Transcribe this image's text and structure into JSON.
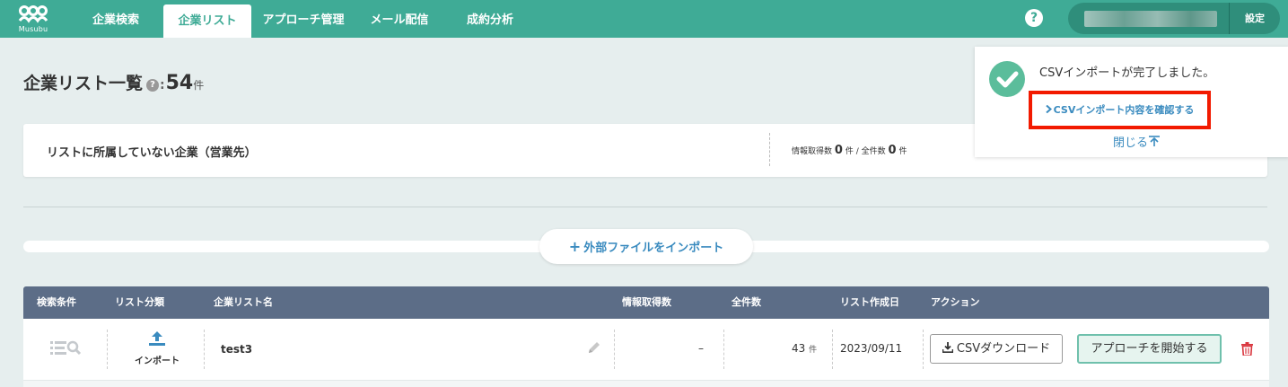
{
  "app": {
    "logo_text": "Musubu"
  },
  "nav": {
    "tabs": [
      {
        "label": "企業検索"
      },
      {
        "label": "企業リスト"
      },
      {
        "label": "アプローチ管理"
      },
      {
        "label": "メール配信"
      },
      {
        "label": "成約分析"
      }
    ],
    "active_tab": "企業リスト",
    "settings_label": "設定",
    "help_glyph": "?"
  },
  "page": {
    "title": "企業リスト一覧",
    "help_glyph": "?",
    "colon": ":",
    "count": "54",
    "count_unit": "件"
  },
  "unassigned": {
    "label": "リストに所属していない企業（営業先）",
    "info_label": "情報取得数",
    "info_count": "0",
    "unit": "件",
    "slash": "/",
    "total_label": "全件数",
    "total_count": "0"
  },
  "import": {
    "plus": "+",
    "label": "外部ファイルをインポート"
  },
  "table": {
    "headers": [
      "検索条件",
      "リスト分類",
      "企業リスト名",
      "情報取得数",
      "全件数",
      "リスト作成日",
      "アクション"
    ],
    "rows": [
      {
        "category": "インポート",
        "name": "test3",
        "info_count": "–",
        "total": "43",
        "total_unit": "件",
        "created": "2023/09/11",
        "csv_label": "CSVダウンロード",
        "approach_label": "アプローチを開始する"
      }
    ]
  },
  "toast": {
    "message": "CSVインポートが完了しました。",
    "confirm_link": "CSVインポート内容を確認する",
    "close_label": "閉じる"
  },
  "colors": {
    "brand": "#3fab96",
    "table_header": "#5c6d87",
    "link": "#3a8bbf",
    "highlight": "#f21a00",
    "delete": "#d9363e"
  }
}
